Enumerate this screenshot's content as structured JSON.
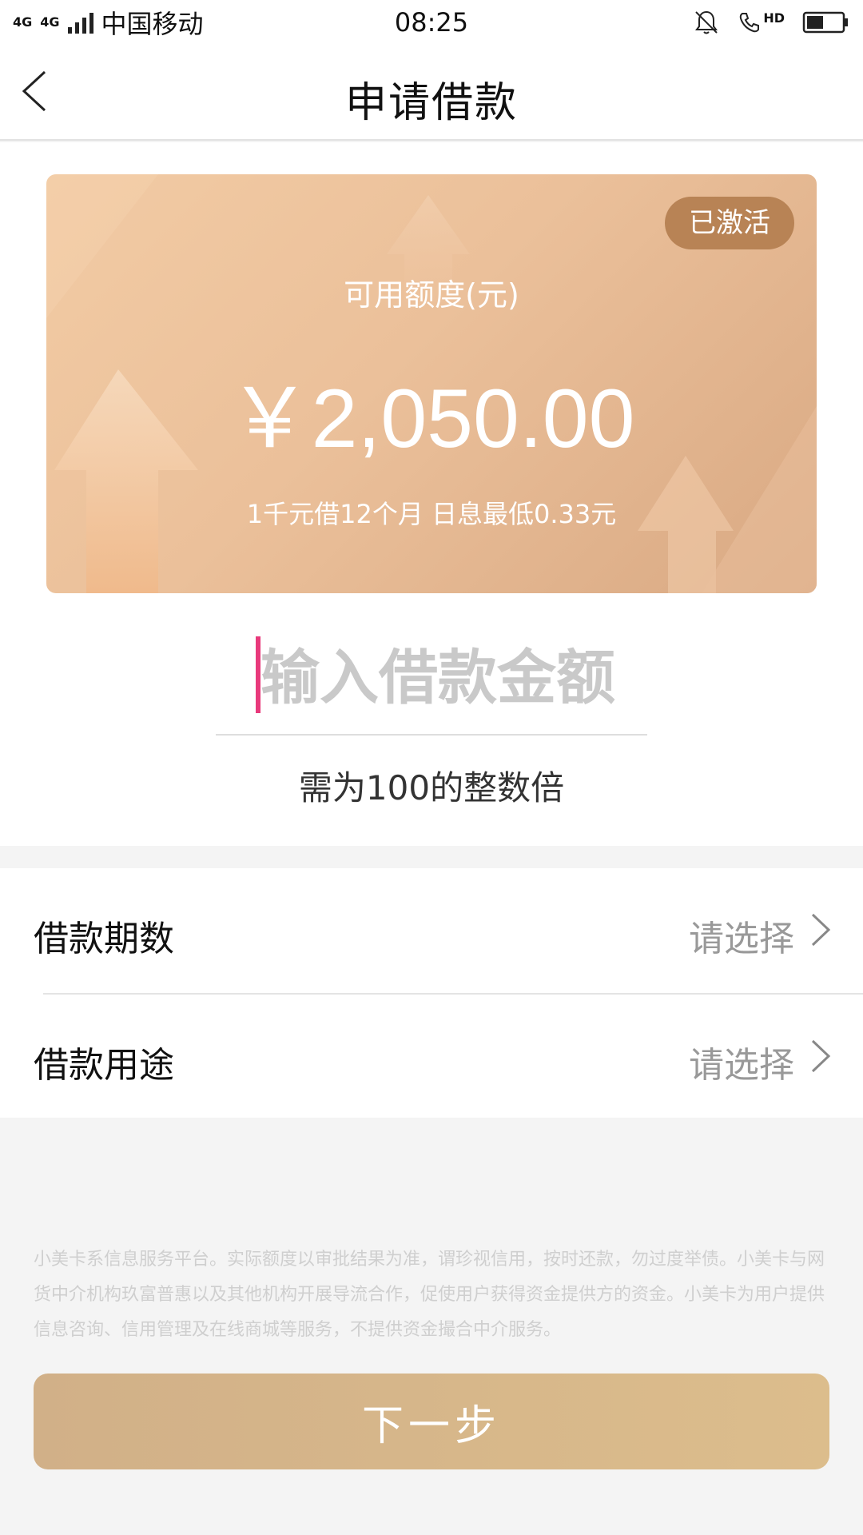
{
  "status_bar": {
    "network_1": "4G",
    "network_2": "4G",
    "carrier": "中国移动",
    "time": "08:25",
    "hd_label": "HD"
  },
  "header": {
    "title": "申请借款"
  },
  "credit_card": {
    "status_badge": "已激活",
    "label": "可用额度(元)",
    "amount": "￥2,050.00",
    "note": "1千元借12个月 日息最低0.33元"
  },
  "amount_input": {
    "placeholder": "输入借款金额",
    "value": "",
    "hint": "需为100的整数倍"
  },
  "options": [
    {
      "label": "借款期数",
      "value": "请选择"
    },
    {
      "label": "借款用途",
      "value": "请选择"
    }
  ],
  "disclaimer": "小美卡系信息服务平台。实际额度以审批结果为准，谓珍视信用，按时还款，勿过度举债。小美卡与网货中介机构玖富普惠以及其他机构开展导流合作，促使用户获得资金提供方的资金。小美卡为用户提供信息咨询、信用管理及在线商城等服务，不提供资金撮合中介服务。",
  "next_button": {
    "label": "下一步"
  },
  "colors": {
    "badge": "#b88355",
    "cursor": "#e8397b",
    "button_start": "#d1b088",
    "button_end": "#dcbd8c"
  }
}
